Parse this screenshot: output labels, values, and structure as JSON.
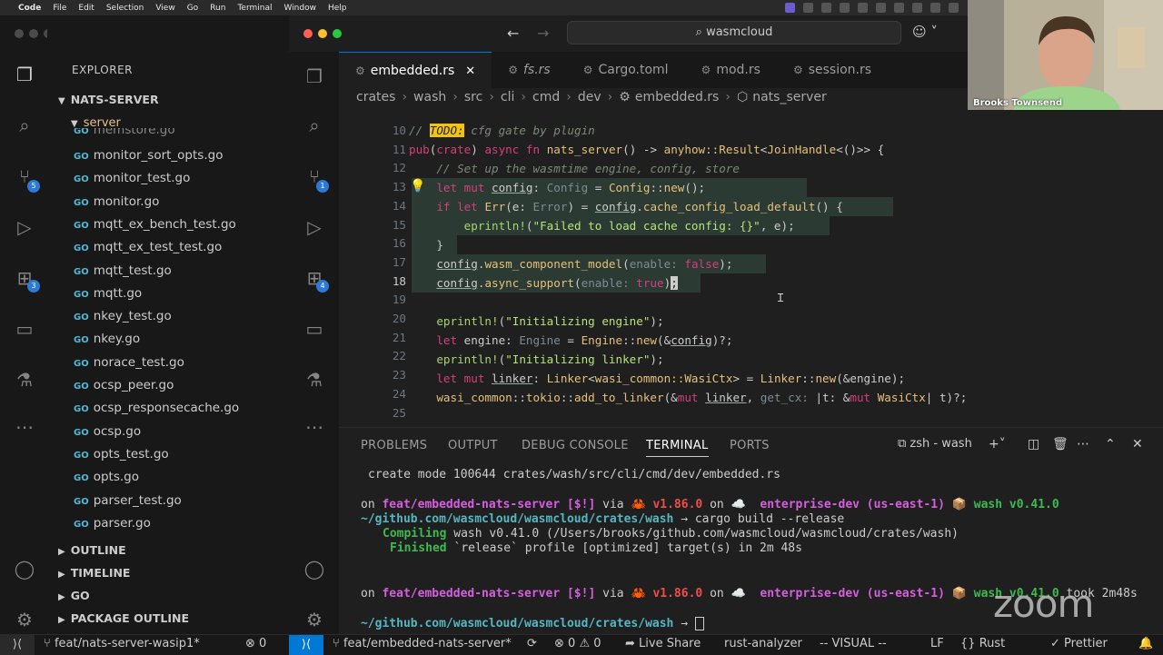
{
  "menubar": {
    "app": "Code",
    "items": [
      "File",
      "Edit",
      "Selection",
      "View",
      "Go",
      "Run",
      "Terminal",
      "Window",
      "Help"
    ]
  },
  "left_window": {
    "explorer_title": "EXPLORER",
    "root": "NATS-SERVER",
    "folder": "server",
    "partial_file": "memstore.go",
    "files": [
      "monitor_sort_opts.go",
      "monitor_test.go",
      "monitor.go",
      "mqtt_ex_bench_test.go",
      "mqtt_ex_test_test.go",
      "mqtt_test.go",
      "mqtt.go",
      "nkey_test.go",
      "nkey.go",
      "norace_test.go",
      "ocsp_peer.go",
      "ocsp_responsecache.go",
      "ocsp.go",
      "opts_test.go",
      "opts.go",
      "parser_test.go",
      "parser.go"
    ],
    "file_icon": "GO",
    "sections": [
      "OUTLINE",
      "TIMELINE",
      "GO",
      "PACKAGE OUTLINE"
    ],
    "badges": {
      "source_control": "5",
      "extensions": "3"
    },
    "status": {
      "branch": "feat/nats-server-wasip1*",
      "errors": "0"
    }
  },
  "main_window": {
    "search": "wasmcloud",
    "tabs": [
      {
        "label": "embedded.rs",
        "active": true,
        "italic": false
      },
      {
        "label": "fs.rs",
        "active": false,
        "italic": true
      },
      {
        "label": "Cargo.toml",
        "active": false,
        "italic": false
      },
      {
        "label": "mod.rs",
        "active": false,
        "italic": false
      },
      {
        "label": "session.rs",
        "active": false,
        "italic": false
      }
    ],
    "breadcrumb": [
      "crates",
      "wash",
      "src",
      "cli",
      "cmd",
      "dev",
      "embedded.rs",
      "nats_server"
    ],
    "badges": {
      "source_control": "1",
      "extensions": "4"
    },
    "line_numbers": [
      "10",
      "11",
      "12",
      "13",
      "14",
      "15",
      "16",
      "17",
      "18",
      "19",
      "20",
      "21",
      "22",
      "23",
      "24",
      "25"
    ],
    "current_line": "18"
  },
  "panel": {
    "tabs": [
      "PROBLEMS",
      "OUTPUT",
      "DEBUG CONSOLE",
      "TERMINAL",
      "PORTS"
    ],
    "active_tab": "TERMINAL",
    "terminal_name": "zsh - wash",
    "lines": {
      "l1": "create mode 100644 crates/wash/src/cli/cmd/dev/embedded.rs",
      "p_on": "on ",
      "branch": "feat/embedded-nats-server [$!]",
      "via": " via ",
      "rust": "🦀 v1.86.0",
      "on2": " on ",
      "cloud": "☁️  enterprise-dev (us-east-1)",
      "wash": "📦 wash v0.41.0",
      "took": " took 2m48s",
      "cwd": "~/github.com/wasmcloud/wasmcloud/crates/wash",
      "arrow": " → ",
      "cmd": "cargo build --release",
      "compiling_kw": "Compiling",
      "compiling": " wash v0.41.0 (/Users/brooks/github.com/wasmcloud/wasmcloud/crates/wash)",
      "finished_kw": "Finished",
      "finished": " `release` profile [optimized] target(s) in 2m 48s"
    }
  },
  "statusbar": {
    "branch": "feat/embedded-nats-server*",
    "errors": "0",
    "warnings": "0",
    "live_share": "Live Share",
    "analyzer": "rust-analyzer",
    "mode": "-- VISUAL --",
    "eol": "LF",
    "lang": "Rust",
    "prettier": "Prettier"
  },
  "webcam": {
    "name": "Brooks Townsend"
  },
  "overlay": {
    "logo": "zoom"
  }
}
